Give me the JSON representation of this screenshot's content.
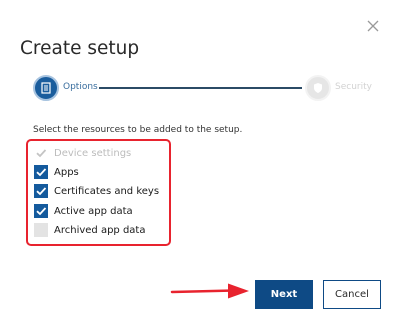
{
  "dialog": {
    "title": "Create setup",
    "close_icon": "close-icon"
  },
  "stepper": {
    "steps": [
      {
        "label": "Options",
        "icon": "document-icon",
        "state": "active"
      },
      {
        "label": "Security",
        "icon": "shield-icon",
        "state": "inactive"
      }
    ]
  },
  "instructions": "Select the resources to be added to the setup.",
  "options": [
    {
      "label": "Device settings",
      "checked": true,
      "disabled": true
    },
    {
      "label": "Apps",
      "checked": true,
      "disabled": false
    },
    {
      "label": "Certificates and keys",
      "checked": true,
      "disabled": false
    },
    {
      "label": "Active app data",
      "checked": true,
      "disabled": false
    },
    {
      "label": "Archived app data",
      "checked": false,
      "disabled": false
    }
  ],
  "buttons": {
    "next": "Next",
    "cancel": "Cancel"
  },
  "colors": {
    "primary": "#0e4a85",
    "highlight": "#e8232e"
  }
}
